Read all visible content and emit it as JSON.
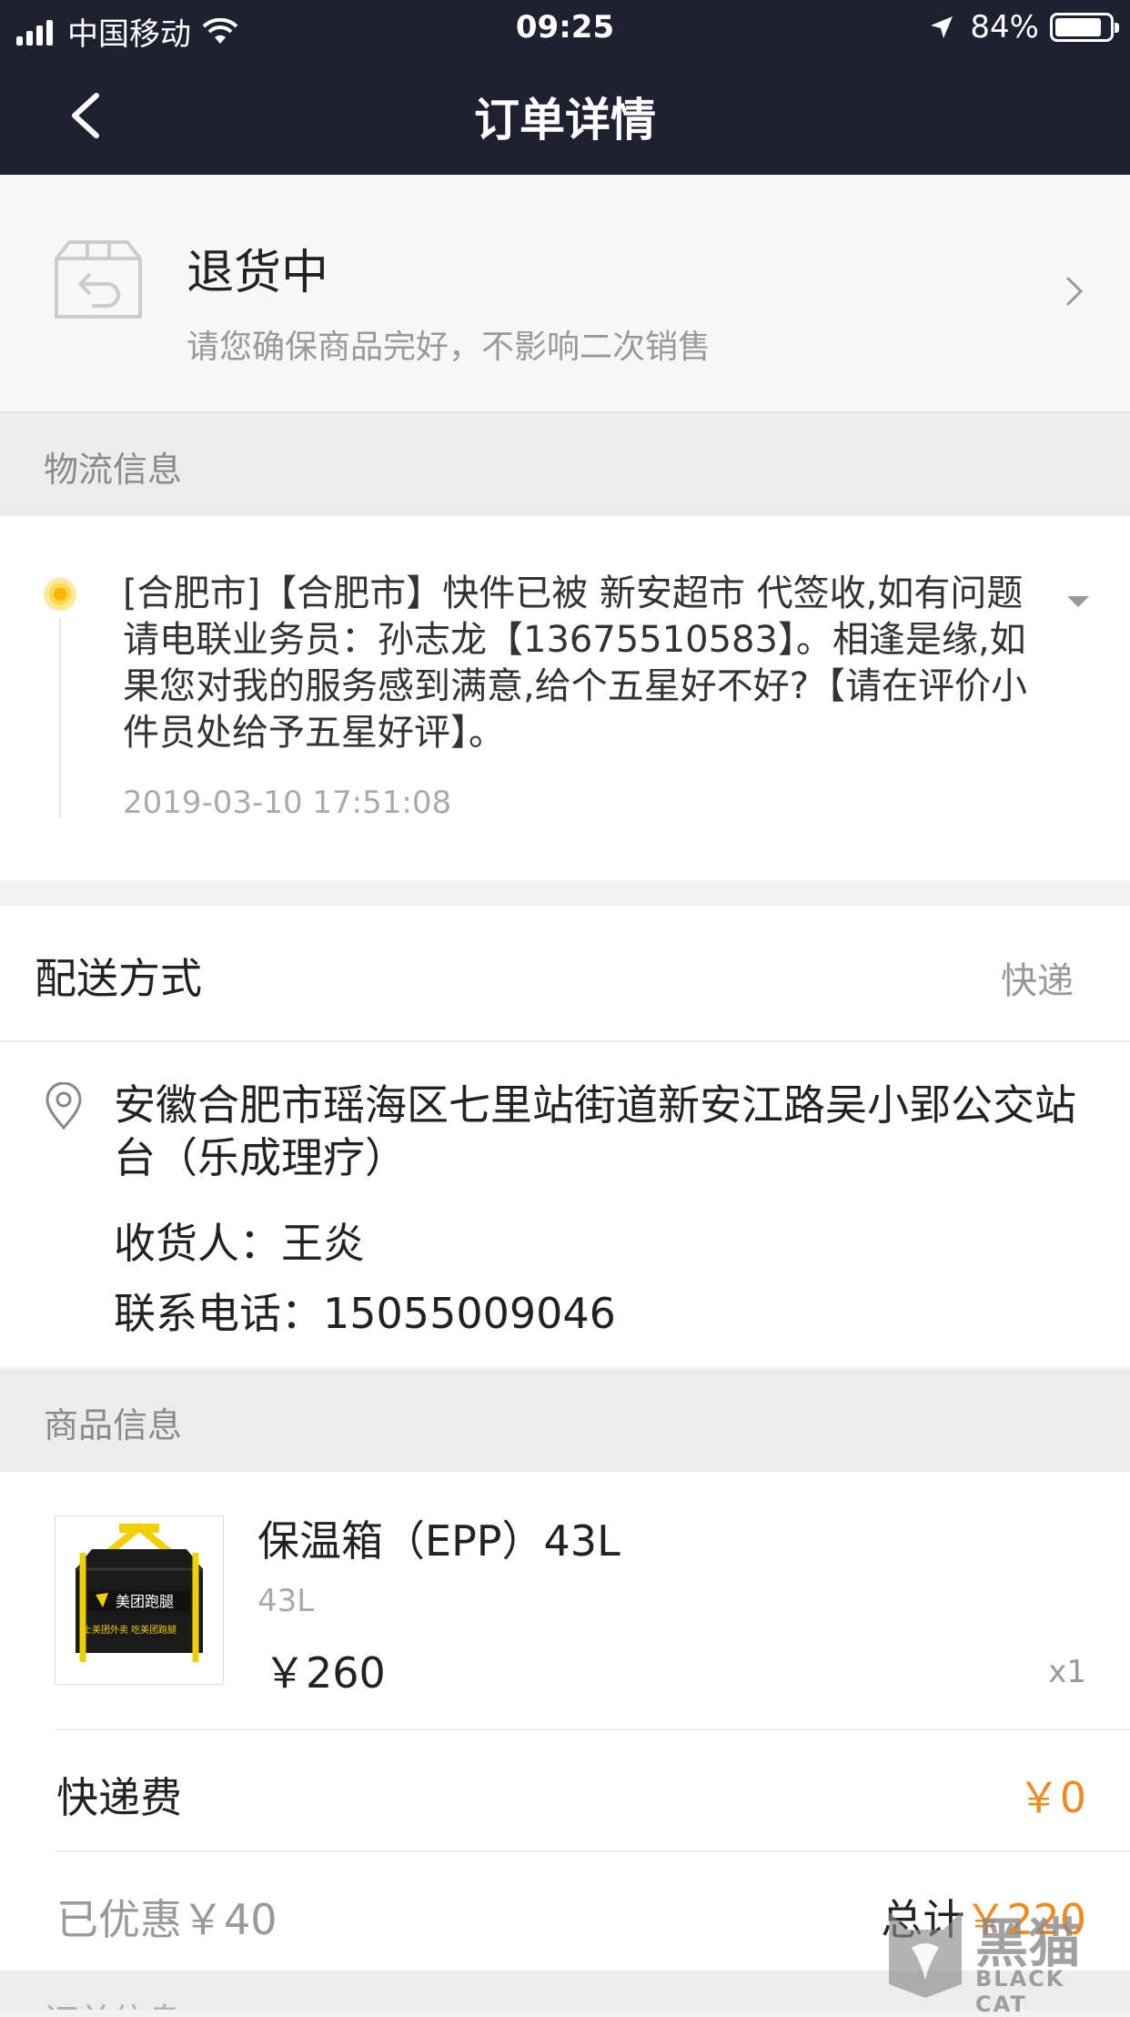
{
  "status_bar": {
    "carrier": "中国移动",
    "time": "09:25",
    "battery": "84%"
  },
  "nav": {
    "title": "订单详情"
  },
  "return_status": {
    "title": "退货中",
    "subtitle": "请您确保商品完好，不影响二次销售"
  },
  "logistics": {
    "header": "物流信息",
    "message": "[合肥市]【合肥市】快件已被 新安超市 代签收,如有问题请电联业务员：孙志龙【13675510583】。相逢是缘,如果您对我的服务感到满意,给个五星好不好?【请在评价小件员处给予五星好评】。",
    "time": "2019-03-10 17:51:08"
  },
  "delivery": {
    "label": "配送方式",
    "value": "快递"
  },
  "address": {
    "text": "安徽合肥市瑶海区七里站街道新安江路吴小郢公交站台（乐成理疗）",
    "receiver": "收货人：王炎",
    "phone": "联系电话：15055009046"
  },
  "product_info": {
    "header": "商品信息",
    "name": "保温箱（EPP）43L",
    "spec": "43L",
    "price": "￥260",
    "qty": "x1",
    "image_text": "美团跑腿",
    "image_subtext": "上美团外卖 吃美团跑腿"
  },
  "fees": {
    "shipping_label": "快递费",
    "shipping_value": "￥0",
    "discount": "已优惠￥40",
    "total_label": "总计",
    "total_value": "￥220"
  },
  "order_info": {
    "header": "订单信息"
  },
  "watermark": {
    "text": "黑猫",
    "subtext": "BLACK CAT"
  },
  "colors": {
    "nav_bg": "#1f2130",
    "accent_orange": "#f08a1c",
    "dot_yellow": "#f5b800"
  }
}
